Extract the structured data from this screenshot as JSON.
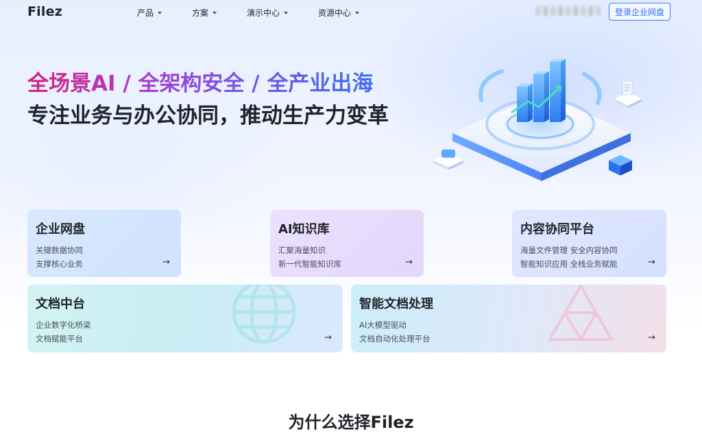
{
  "header": {
    "logo": "Filez",
    "nav": [
      {
        "label": "产品"
      },
      {
        "label": "方案"
      },
      {
        "label": "演示中心"
      },
      {
        "label": "资源中心"
      }
    ],
    "login_label": "登录企业网盘"
  },
  "hero": {
    "headline": "全场景AI / 全架构安全 / 全产业出海",
    "subheadline": "专注业务与办公协同，推动生产力变革"
  },
  "cards": [
    {
      "title": "企业网盘",
      "line1": "关键数据协同",
      "line2": "支撑核心业务",
      "arrow": "→"
    },
    {
      "title": "AI知识库",
      "line1": "汇聚海量知识",
      "line2": "新一代智能知识库",
      "arrow": "→"
    },
    {
      "title": "内容协同平台",
      "line1": "海量文件管理 安全内容协同",
      "line2": "智能知识应用 全栈业务赋能",
      "arrow": "→"
    },
    {
      "title": "文档中台",
      "line1": "企业数字化桥梁",
      "line2": "文档赋能平台",
      "arrow": "→"
    },
    {
      "title": "智能文档处理",
      "line1": "AI大模型驱动",
      "line2": "文档自动化处理平台",
      "arrow": "→"
    }
  ],
  "why_section": {
    "title": "为什么选择Filez"
  },
  "colors": {
    "accent_blue": "#2f6ef6",
    "headline_gradient_start": "#d4237a",
    "headline_gradient_end": "#3f6ff0"
  },
  "icons": [
    "caret-down-icon",
    "arrow-right-icon"
  ]
}
